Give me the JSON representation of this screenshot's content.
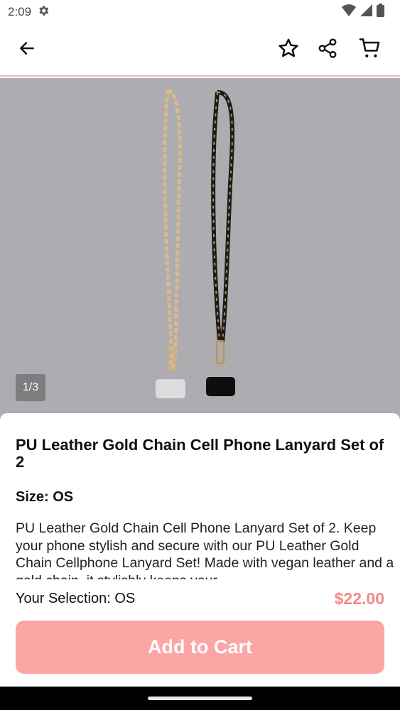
{
  "status": {
    "time": "2:09",
    "settings_icon": "gear-icon",
    "wifi_icon": "wifi-icon",
    "signal_icon": "signal-icon",
    "battery_icon": "battery-icon"
  },
  "header": {
    "back_icon": "arrow-left-icon",
    "favorite_icon": "star-icon",
    "share_icon": "share-icon",
    "cart_icon": "cart-icon",
    "accent": "#f2b8b8"
  },
  "gallery": {
    "counter": "1/3",
    "background": "#adacb0"
  },
  "product": {
    "title": "PU Leather Gold Chain Cell Phone Lanyard Set of 2",
    "size": "Size: OS",
    "description": "PU Leather Gold Chain Cell Phone Lanyard Set of 2. Keep your phone stylish and secure with our PU Leather Gold Chain Cellphone Lanyard Set! Made with vegan leather and a gold chain, it stylishly keeps your"
  },
  "purchase": {
    "selection": "Your Selection: OS",
    "price": "$22.00",
    "price_color": "#f0898a",
    "add_to_cart": "Add to Cart",
    "button_color": "#fca5a5"
  }
}
